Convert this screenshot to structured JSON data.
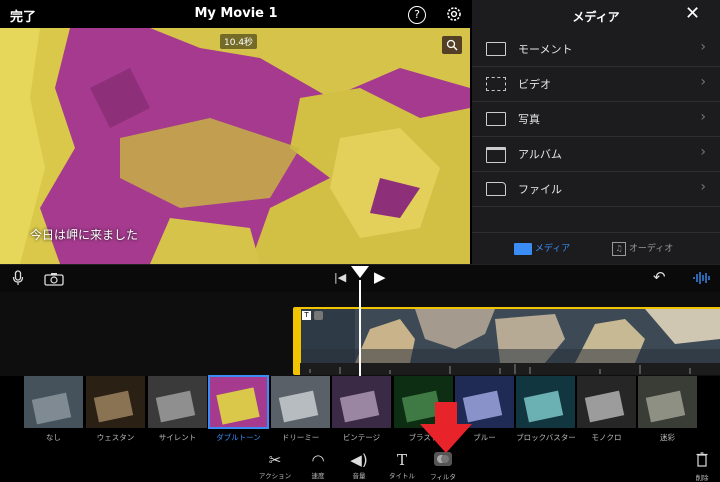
{
  "top": {
    "done_label": "完了",
    "movie_title": "My Movie 1",
    "help_icon": "?"
  },
  "preview": {
    "duration": "10.4秒",
    "subtitle": "今日は岬に来ました"
  },
  "media": {
    "title": "メディア",
    "rows": [
      {
        "label": "モーメント",
        "icon": "moments-icon"
      },
      {
        "label": "ビデオ",
        "icon": "film-icon"
      },
      {
        "label": "写真",
        "icon": "photo-icon"
      },
      {
        "label": "アルバム",
        "icon": "album-icon"
      },
      {
        "label": "ファイル",
        "icon": "folder-icon"
      }
    ],
    "tabs": [
      {
        "label": "メディア",
        "active": true
      },
      {
        "label": "オーディオ",
        "active": false
      }
    ]
  },
  "filters": [
    {
      "label": "なし"
    },
    {
      "label": "ウェスタン"
    },
    {
      "label": "サイレント"
    },
    {
      "label": "ダブルトーン",
      "selected": true
    },
    {
      "label": "ドリーミー"
    },
    {
      "label": "ビンテージ"
    },
    {
      "label": "ブラスト"
    },
    {
      "label": "ブルー"
    },
    {
      "label": "ブロックバスター"
    },
    {
      "label": "モノクロ"
    },
    {
      "label": "迷彩"
    }
  ],
  "toolbar": {
    "tools": [
      {
        "label": "アクション",
        "icon": "scissors-icon"
      },
      {
        "label": "速度",
        "icon": "speedometer-icon"
      },
      {
        "label": "音量",
        "icon": "speaker-icon"
      },
      {
        "label": "タイトル",
        "icon": "title-t-icon"
      },
      {
        "label": "フィルタ",
        "icon": "filter-icon",
        "active": true
      }
    ],
    "delete_label": "削除"
  },
  "colors": {
    "accent": "#3a8df5",
    "clip_border": "#f2c400",
    "arrow": "#e8232a",
    "duotone_a": "#a53a8e",
    "duotone_b": "#d9c84a"
  }
}
